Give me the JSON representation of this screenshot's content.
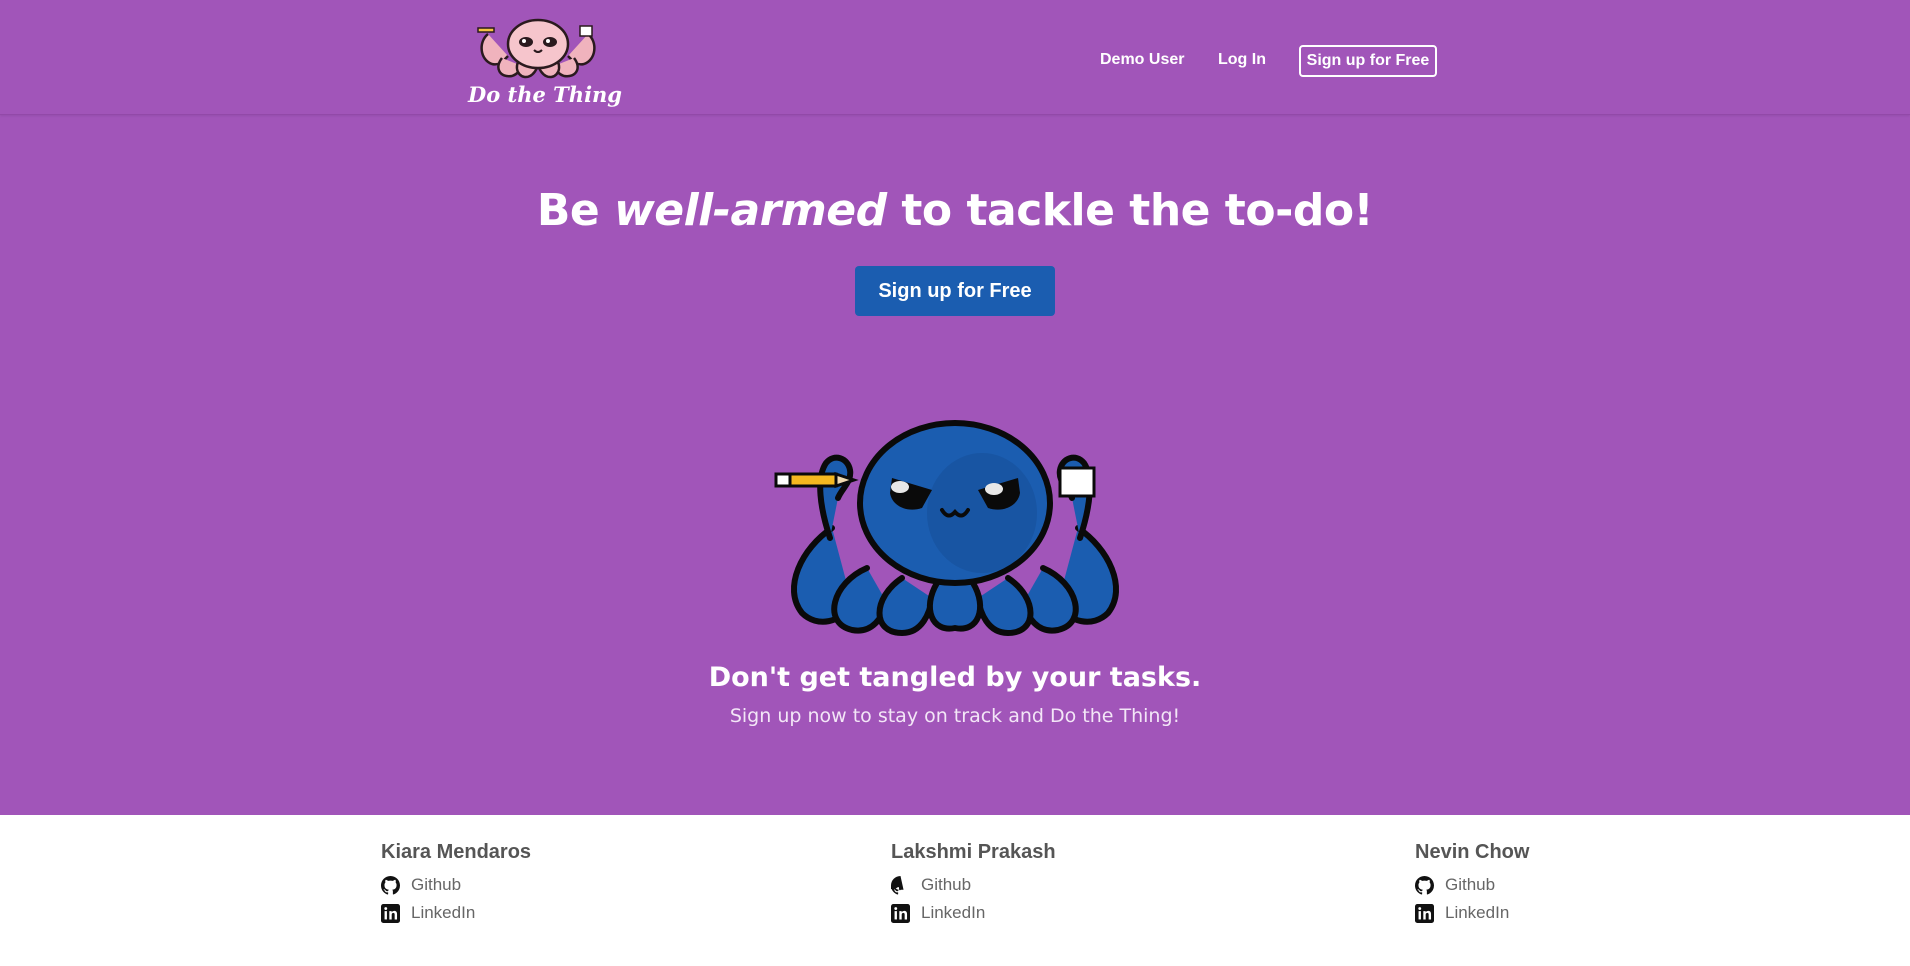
{
  "header": {
    "logo_text": "Do the Thing",
    "nav": {
      "demo_user": "Demo User",
      "log_in": "Log In",
      "sign_up": "Sign up for Free"
    }
  },
  "hero": {
    "headline_before": "Be ",
    "headline_emphasis": "well-armed",
    "headline_after": " to tackle the to-do!",
    "cta_label": "Sign up for Free",
    "tagline": "Don't get tangled by your tasks.",
    "subline": "Sign up now to stay on track and Do the Thing!"
  },
  "footer": {
    "team": [
      {
        "name": "Kiara Mendaros",
        "links": [
          {
            "label": "Github",
            "icon": "github-icon"
          },
          {
            "label": "LinkedIn",
            "icon": "linkedin-icon"
          }
        ]
      },
      {
        "name": "Lakshmi Prakash",
        "links": [
          {
            "label": "Github",
            "icon": "github-icon"
          },
          {
            "label": "LinkedIn",
            "icon": "linkedin-icon"
          }
        ]
      },
      {
        "name": "Nevin Chow",
        "links": [
          {
            "label": "Github",
            "icon": "github-icon"
          },
          {
            "label": "LinkedIn",
            "icon": "linkedin-icon"
          }
        ]
      }
    ]
  },
  "colors": {
    "hero_background": "#a155b9",
    "cta_background": "#1b5db0",
    "mascot_body": "#1b5db0",
    "logo_mascot_body": "#f6c5cc",
    "footer_background": "#ffffff"
  }
}
